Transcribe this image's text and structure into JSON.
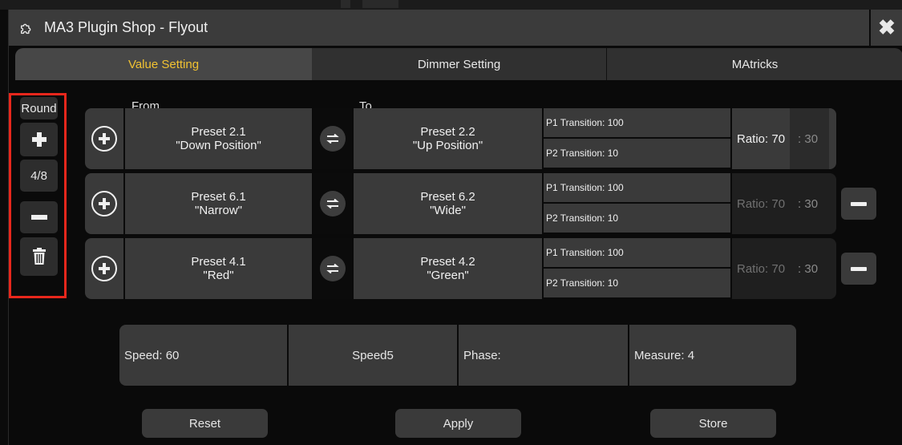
{
  "window": {
    "title": "MA3 Plugin Shop - Flyout",
    "icon": "puzzle-icon",
    "close_icon": "close-icon"
  },
  "tabs": [
    {
      "label": "Value Setting",
      "active": true
    },
    {
      "label": "Dimmer Setting",
      "active": false
    },
    {
      "label": "MAtricks",
      "active": false
    }
  ],
  "sidebar": {
    "round_label": "Round",
    "counter": "4/8",
    "add_icon": "plus-icon",
    "remove_icon": "minus-icon",
    "delete_icon": "trash-icon"
  },
  "columns": {
    "from": "From",
    "to": "To"
  },
  "rows": [
    {
      "from_line1": "Preset 2.1",
      "from_line2": "\"Down Position\"",
      "to_line1": "Preset 2.2",
      "to_line2": "\"Up Position\"",
      "p1": "P1 Transition: 100",
      "p2": "P2 Transition: 10",
      "ratio": "Ratio: 70",
      "ratio_rest": ": 30",
      "removable": false
    },
    {
      "from_line1": "Preset 6.1",
      "from_line2": "\"Narrow\"",
      "to_line1": "Preset 6.2",
      "to_line2": "\"Wide\"",
      "p1": "P1 Transition: 100",
      "p2": "P2 Transition: 10",
      "ratio": "Ratio: 70",
      "ratio_rest": ": 30",
      "removable": true
    },
    {
      "from_line1": "Preset 4.1",
      "from_line2": "\"Red\"",
      "to_line1": "Preset 4.2",
      "to_line2": "\"Green\"",
      "p1": "P1 Transition: 100",
      "p2": "P2 Transition: 10",
      "ratio": "Ratio: 70",
      "ratio_rest": ": 30",
      "removable": true
    }
  ],
  "bottom": {
    "speed": "Speed: 60",
    "speed_group": "Speed5",
    "phase": "Phase:",
    "measure": "Measure: 4"
  },
  "actions": {
    "reset": "Reset",
    "apply": "Apply",
    "store": "Store"
  },
  "colors": {
    "active_tab": "#f1c232",
    "highlight_border": "#e8271c"
  }
}
